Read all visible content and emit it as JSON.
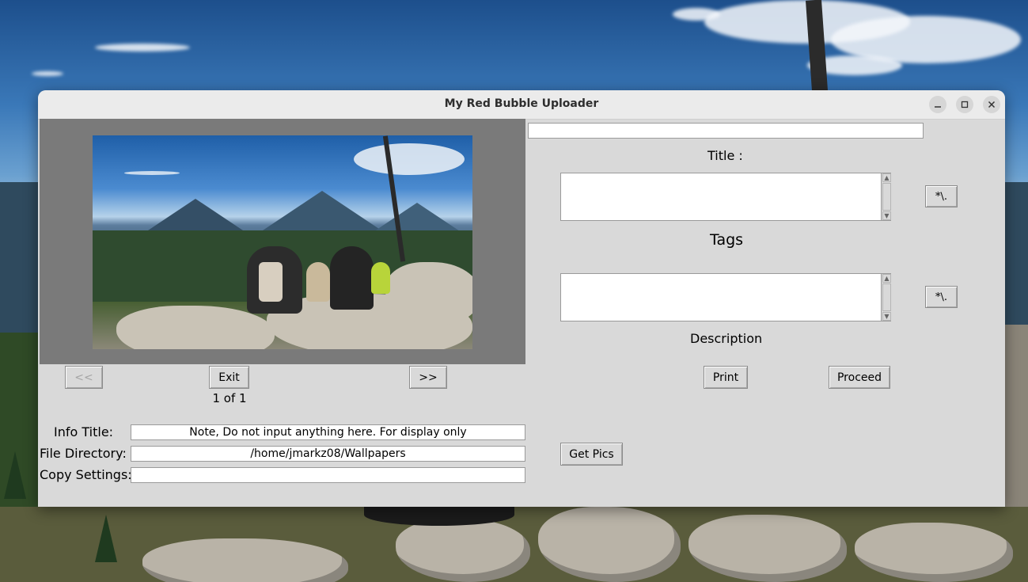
{
  "window": {
    "title": "My Red Bubble Uploader"
  },
  "icons": {
    "minimize": "minimize-icon",
    "maximize": "maximize-icon",
    "close": "close-icon"
  },
  "navigation": {
    "prev_label": "<<",
    "exit_label": "Exit",
    "next_label": ">>",
    "counter": "1 of 1"
  },
  "info": {
    "info_title_label": "Info Title:",
    "info_title_value": "Note, Do not input anything here. For display only",
    "file_directory_label": "File Directory:",
    "file_directory_value": "/home/jmarkz08/Wallpapers",
    "copy_settings_label": "Copy Settings:",
    "copy_settings_value": ""
  },
  "right": {
    "top_entry_value": "",
    "title_label": "Title :",
    "tags_label": "Tags",
    "description_label": "Description",
    "regex_button_1": "*\\.",
    "regex_button_2": "*\\.",
    "print_label": "Print",
    "proceed_label": "Proceed",
    "get_pics_label": "Get Pics"
  }
}
